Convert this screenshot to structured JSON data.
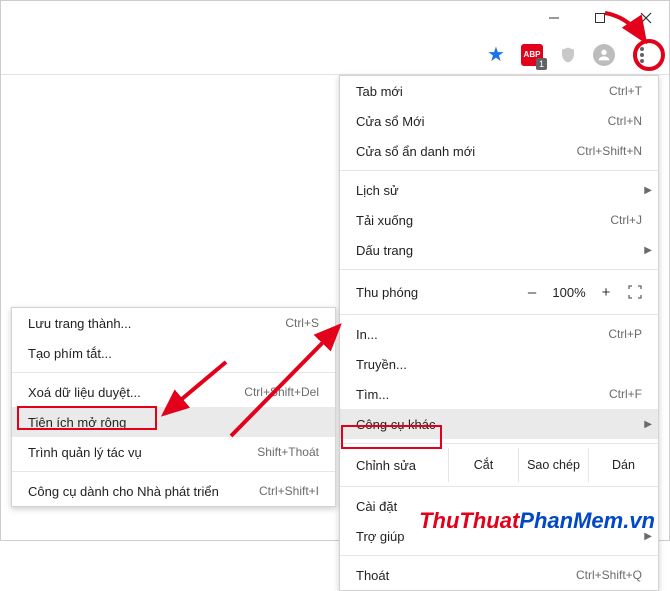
{
  "titlebar": {
    "min": "minimize",
    "max": "maximize",
    "close": "close"
  },
  "toolbar": {
    "star": "bookmark-star",
    "abp": "ABP",
    "abp_badge": "1",
    "shield": "privacy-shield",
    "avatar": "profile",
    "kebab": "menu"
  },
  "menu": {
    "new_tab": {
      "label": "Tab mới",
      "shortcut": "Ctrl+T"
    },
    "new_window": {
      "label": "Cửa sổ Mới",
      "shortcut": "Ctrl+N"
    },
    "incognito": {
      "label": "Cửa sổ ẩn danh mới",
      "shortcut": "Ctrl+Shift+N"
    },
    "history": {
      "label": "Lịch sử"
    },
    "downloads": {
      "label": "Tải xuống",
      "shortcut": "Ctrl+J"
    },
    "bookmarks": {
      "label": "Dấu trang"
    },
    "zoom": {
      "label": "Thu phóng",
      "minus": "–",
      "value": "100%",
      "plus": "+"
    },
    "print": {
      "label": "In...",
      "shortcut": "Ctrl+P"
    },
    "cast": {
      "label": "Truyền..."
    },
    "find": {
      "label": "Tìm...",
      "shortcut": "Ctrl+F"
    },
    "more_tools": {
      "label": "Công cụ khác"
    },
    "edit": {
      "label": "Chỉnh sửa",
      "cut": "Cắt",
      "copy": "Sao chép",
      "paste": "Dán"
    },
    "settings": {
      "label": "Cài đặt"
    },
    "help": {
      "label": "Trợ giúp"
    },
    "exit": {
      "label": "Thoát",
      "shortcut": "Ctrl+Shift+Q"
    }
  },
  "submenu": {
    "save_page": {
      "label": "Lưu trang thành...",
      "shortcut": "Ctrl+S"
    },
    "create_shortcut": {
      "label": "Tạo phím tắt..."
    },
    "clear_data": {
      "label": "Xoá dữ liệu duyệt...",
      "shortcut": "Ctrl+Shift+Del"
    },
    "extensions": {
      "label": "Tiện ích mở rộng"
    },
    "task_manager": {
      "label": "Trình quản lý tác vụ",
      "shortcut": "Shift+Thoát"
    },
    "dev_tools": {
      "label": "Công cụ dành cho Nhà phát triển",
      "shortcut": "Ctrl+Shift+I"
    }
  },
  "watermark": {
    "p1": "ThuThuat",
    "p2": "PhanMem.vn"
  }
}
